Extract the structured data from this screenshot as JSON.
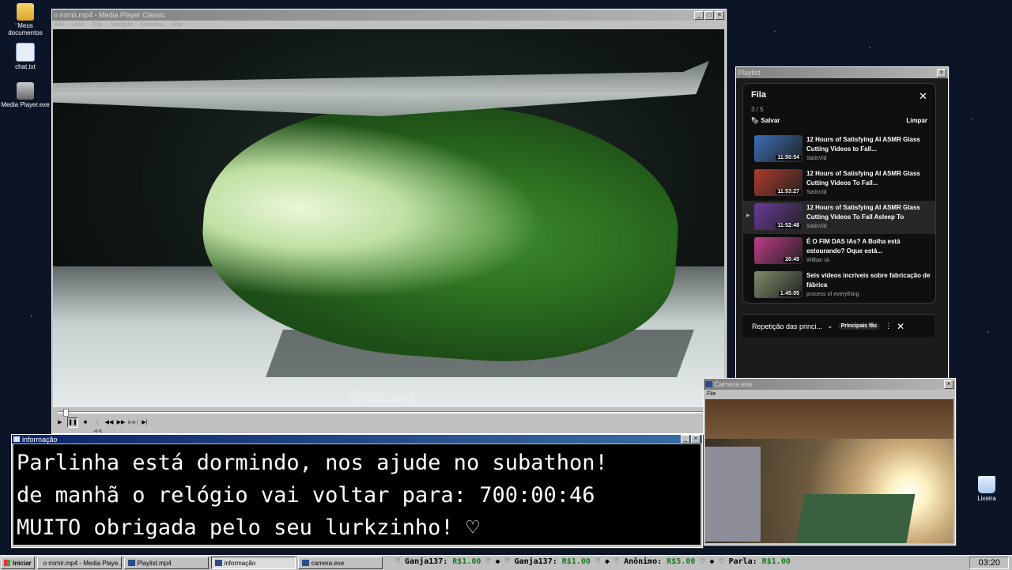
{
  "desktop": {
    "icons": [
      {
        "label": "Meus documentos",
        "icon": "folder-icon"
      },
      {
        "label": "chat.txt",
        "icon": "text-file-icon"
      },
      {
        "label": "Media Player.exe",
        "icon": "media-player-icon"
      },
      {
        "label": "Lixeira",
        "icon": "recycle-bin-icon"
      }
    ]
  },
  "player": {
    "title": "o mimir.mp4 - Media Player Classic",
    "menu": [
      "File",
      "View",
      "Play",
      "Navigate",
      "Favorites",
      "Help"
    ],
    "watermark": "@Satisvid",
    "progress": 0.01,
    "controls": [
      "play",
      "pause",
      "stop",
      "prev",
      "rewind",
      "forward",
      "next",
      "frame-step"
    ]
  },
  "playlist_window": {
    "title": "Playlist",
    "queue": {
      "title": "Fila",
      "count": "3 / 5",
      "save_label": "Salvar",
      "clear_label": "Limpar",
      "items": [
        {
          "title": "12 Hours of Satisfying AI ASMR Glass Cutting Videos to Fall...",
          "channel": "SatisVid",
          "duration": "11:50:54",
          "thumb": "#3a6fb8"
        },
        {
          "title": "12 Hours of Satisfying AI ASMR Glass Cutting Videos To Fall...",
          "channel": "SatisVid",
          "duration": "11:53:27",
          "thumb": "#b23a2c"
        },
        {
          "title": "12 Hours of Satisfying AI ASMR Glass Cutting Videos To Fall Asleep To",
          "channel": "SatisVid",
          "duration": "11:52:48",
          "thumb": "#6a3a9c",
          "current": true
        },
        {
          "title": "É O FIM DAS IAs? A Bolha está estourando? Oque está...",
          "channel": "Willian IA",
          "duration": "20:45",
          "thumb": "#c23b8a"
        },
        {
          "title": "Seis vídeos incríveis sobre fabricação de fábrica",
          "channel": "process of everything",
          "duration": "1:45:05",
          "thumb": "#7d8c6a"
        }
      ],
      "footer_label": "Repetição das princi...",
      "footer_badge": "Principais fãs"
    }
  },
  "camera_window": {
    "title": "Camera.exe",
    "menu": [
      "File"
    ]
  },
  "info_window": {
    "title": "informação",
    "lines": [
      "Parlinha está dormindo, nos ajude no subathon!",
      "de manhã o relógio vai voltar para:  700:00:46",
      "MUITO obrigada pelo seu lurkzinho! ♡"
    ]
  },
  "taskbar": {
    "start_label": "Iniciar",
    "tasks": [
      {
        "label": "o mimir.mp4 - Media Playe...",
        "active": false
      },
      {
        "label": "Playlist.mp4",
        "active": false
      },
      {
        "label": "informação",
        "active": true
      },
      {
        "label": "camera.exe",
        "active": false
      }
    ],
    "ticker": [
      {
        "name": "Ganja137:",
        "amount": "R$1.00"
      },
      {
        "name": "Ganja137:",
        "amount": "R$1.00"
      },
      {
        "name": "Anônimo:",
        "amount": "R$5.00"
      },
      {
        "name": "Parla:",
        "amount": "R$1.00"
      }
    ],
    "clock": "03:20"
  }
}
